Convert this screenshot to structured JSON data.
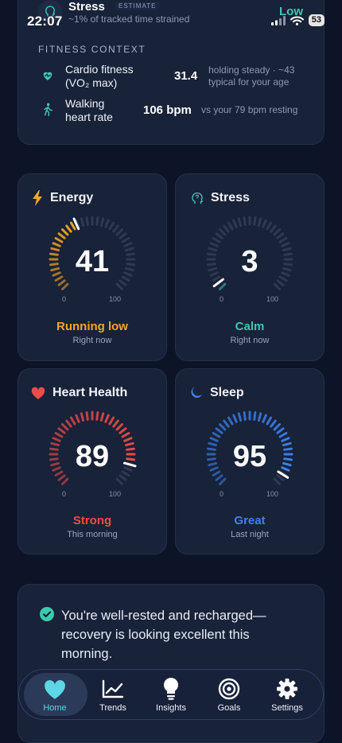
{
  "status_bar": {
    "time": "22:07",
    "battery": "53"
  },
  "stress_header": {
    "title": "Stress",
    "badge": "ESTIMATE",
    "subtitle": "~1% of tracked time strained",
    "level": "Low"
  },
  "fitness_context": {
    "heading": "FITNESS CONTEXT",
    "rows": [
      {
        "label_main": "Cardio fitness",
        "label_sub": "(VO₂ max)",
        "value": "31.4",
        "note_1": "holding steady · ~43",
        "note_2": "typical for your age",
        "icon": "heart-pulse-icon"
      },
      {
        "label_main": "Walking",
        "label_sub": "heart rate",
        "value": "106 bpm",
        "note_1": "vs your 79 bpm resting",
        "note_2": "",
        "icon": "walking-icon"
      }
    ]
  },
  "cards": [
    {
      "title": "Energy",
      "icon": "lightning-icon",
      "score": "41",
      "value": 41,
      "max_label": "100",
      "min_label": "0",
      "status": "Running low",
      "when": "Right now",
      "color": "#f5a623"
    },
    {
      "title": "Stress",
      "icon": "brain-head-icon",
      "score": "3",
      "value": 3,
      "max_label": "100",
      "min_label": "0",
      "status": "Calm",
      "when": "Right now",
      "color": "#3cc9b0"
    },
    {
      "title": "Heart Health",
      "icon": "heart-icon",
      "score": "89",
      "value": 89,
      "max_label": "100",
      "min_label": "0",
      "status": "Strong",
      "when": "This morning",
      "color": "#ef4b4b"
    },
    {
      "title": "Sleep",
      "icon": "moon-icon",
      "score": "95",
      "value": 95,
      "max_label": "100",
      "min_label": "0",
      "status": "Great",
      "when": "Last night",
      "color": "#3d83f0"
    }
  ],
  "message": {
    "text": "You're well-rested and recharged—recovery is looking excellent this morning."
  },
  "tabs": [
    {
      "label": "Home",
      "icon": "heart-icon",
      "active": true
    },
    {
      "label": "Trends",
      "icon": "trend-chart-icon",
      "active": false
    },
    {
      "label": "Insights",
      "icon": "lightbulb-icon",
      "active": false
    },
    {
      "label": "Goals",
      "icon": "target-icon",
      "active": false
    },
    {
      "label": "Settings",
      "icon": "gear-icon",
      "active": false
    }
  ],
  "colors": {
    "accent": "#5fd6e6",
    "background": "#0d1428",
    "card": "#182238",
    "track": "#2f3a50"
  }
}
